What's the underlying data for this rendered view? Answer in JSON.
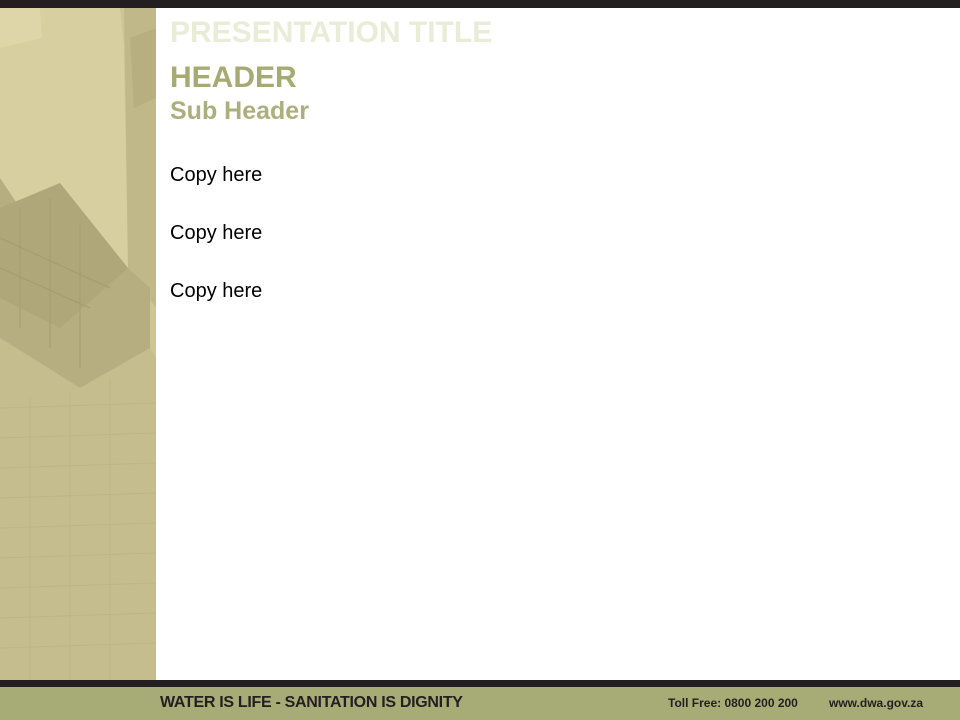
{
  "slide": {
    "presentation_title": "PRESENTATION TITLE",
    "header": "HEADER",
    "sub_header": "Sub Header",
    "copy": [
      "Copy here",
      "Copy here",
      "Copy here"
    ]
  },
  "footer": {
    "slogan": "WATER IS LIFE - SANITATION IS DIGNITY",
    "toll_free": "Toll Free: 0800 200 200",
    "website": "www.dwa.gov.za"
  },
  "colors": {
    "header": "#a5ab73",
    "footer_band": "#a7ab75",
    "dark_bar": "#231f20"
  }
}
